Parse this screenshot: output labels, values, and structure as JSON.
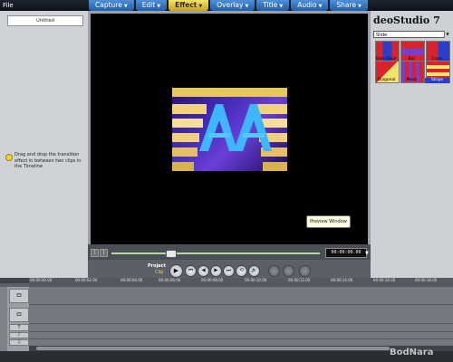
{
  "menu": {
    "file": "File"
  },
  "tabs": [
    {
      "label": "Capture",
      "arrow": "▼"
    },
    {
      "label": "Edit",
      "arrow": "▼"
    },
    {
      "label": "Effect",
      "arrow": "▼"
    },
    {
      "label": "Overlay",
      "arrow": "▼"
    },
    {
      "label": "Title",
      "arrow": "▼"
    },
    {
      "label": "Audio",
      "arrow": "▼"
    },
    {
      "label": "Share",
      "arrow": "▼"
    }
  ],
  "active_tab": "Effect",
  "left_panel": {
    "clip_name": "Untitled",
    "tip": "Drag and drop the transition effect in between two clips in the Timeline"
  },
  "preview": {
    "tooltip": "Preview Window",
    "timecode": "00:00:00.00",
    "trim_left": "[",
    "trim_right": "]"
  },
  "right_panel": {
    "app_title": "deoStudio 7",
    "category": "Slide",
    "category_arrow": "▼",
    "transitions": [
      {
        "label": "Barn Door",
        "selected": false
      },
      {
        "label": "Bar",
        "selected": false
      },
      {
        "label": "Cross",
        "selected": false
      },
      {
        "label": "Diagonal",
        "selected": false
      },
      {
        "label": "Mesh",
        "selected": false
      },
      {
        "label": "Stripe",
        "selected": true
      }
    ]
  },
  "playback": {
    "project_label": "Project",
    "clip_label": "Clip",
    "buttons": [
      "▶",
      "⏮",
      "◀",
      "▶",
      "⏭",
      "⟲",
      "🔊"
    ]
  },
  "timeline": {
    "ticks": [
      "00:00:00.00",
      "00:00:02.00",
      "00:00:04.00",
      "00:00:06.00",
      "00:00:08.00",
      "00:00:10.00",
      "00:00:12.00",
      "00:00:14.00",
      "00:00:16.00",
      "00:00:18.00"
    ]
  },
  "watermark": "BodNara",
  "colors": {
    "accent_tab": "#4d8fd8",
    "active_tab": "#f4e36a",
    "selection": "#2a3fc9"
  }
}
